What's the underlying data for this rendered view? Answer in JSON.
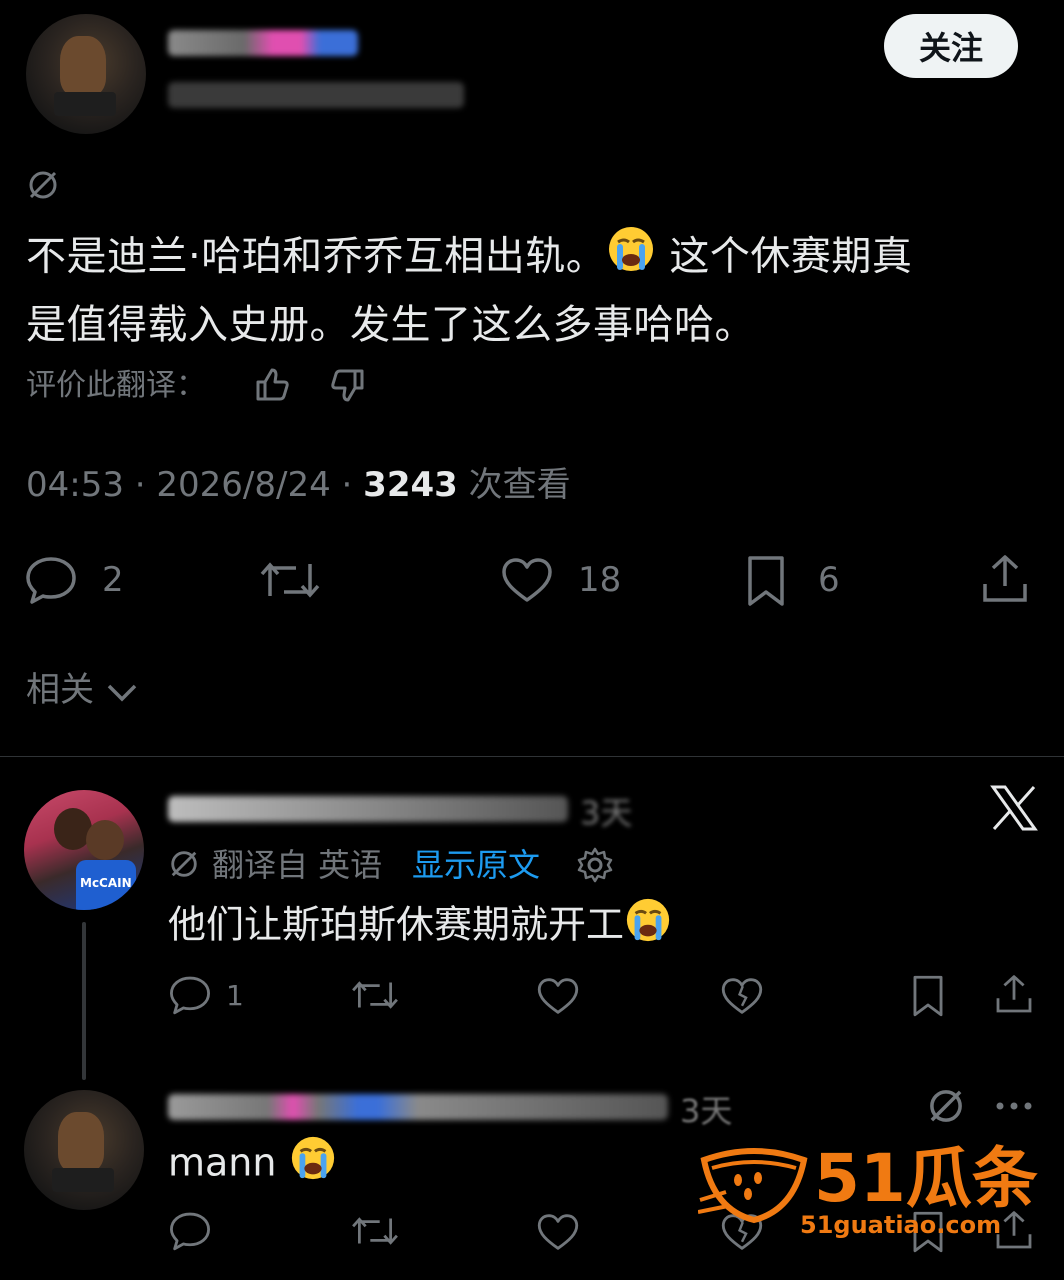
{
  "main_tweet": {
    "follow_label": "关注",
    "text_line1": "不是迪兰·哈珀和乔乔互相出轨。",
    "text_line1b": " 这个休赛期真",
    "text_line2": "是值得载入史册。发生了这么多事哈哈。",
    "rate_translation_label": "评价此翻译：",
    "timestamp": "04:53 · 2026/8/24 · ",
    "views_count": "3243",
    "views_label": " 次查看",
    "reply_count": "2",
    "like_count": "18",
    "bookmark_count": "6",
    "related_label": "相关"
  },
  "reply1": {
    "translated_from": "翻译自 英语",
    "show_original": "显示原文",
    "text": "他们让斯珀斯休赛期就开工",
    "reply_count": "1",
    "avatar_jersey": "McCAIN"
  },
  "reply2": {
    "time_fragment": "3天",
    "text": "mann"
  },
  "reply1_time_fragment": "3天",
  "watermark": {
    "brand": "51瓜条",
    "url": "51guatiao.com"
  },
  "colors": {
    "background": "#000000",
    "text": "#e7e9ea",
    "muted": "#71767b",
    "link": "#1d9bf0",
    "watermark": "#f07a12"
  }
}
